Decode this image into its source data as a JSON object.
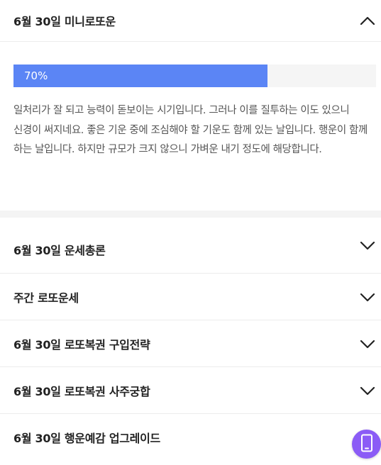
{
  "mini_fortune": {
    "title": "6월 30일 미니로또운",
    "progress": 70,
    "progress_label": "70%",
    "text": "일처리가 잘 되고 능력이 돋보이는 시기입니다. 그러나 이를 질투하는 이도 있으니 신경이 써지네요. 좋은 기운 중에 조심해야 할 기운도 함께 있는 날입니다. 행운이 함께 하는 날입니다. 하지만 규모가 크지 않으니 가벼운 내기 정도에 해당합니다."
  },
  "sections": [
    {
      "label": "6월 30일 운세총론"
    },
    {
      "label": "주간 로또운세"
    },
    {
      "label": "6월 30일 로또복권 구입전략"
    },
    {
      "label": "6월 30일 로또복권 사주궁합"
    },
    {
      "label": "6월 30일 행운예감 업그레이드"
    }
  ],
  "colors": {
    "progress_fill": "#5b85f5",
    "fab": "#8b5cf6"
  },
  "icons": {
    "collapse": "chevron-up-icon",
    "expand": "chevron-down-icon",
    "fab": "mobile-phone-icon"
  }
}
